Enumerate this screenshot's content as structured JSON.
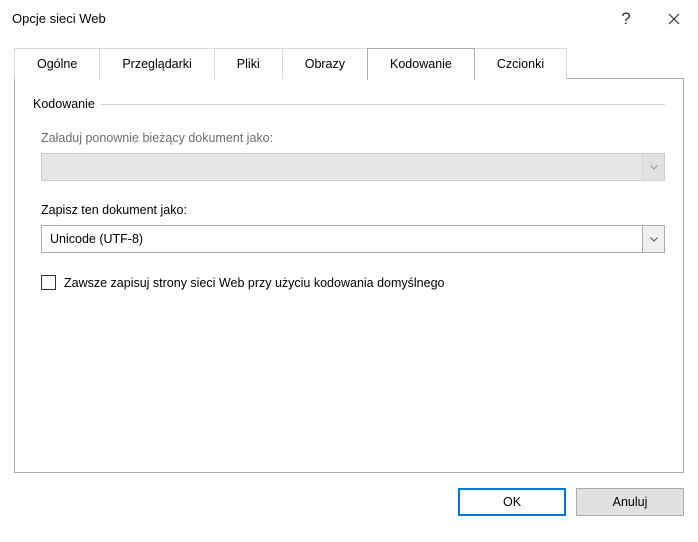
{
  "window": {
    "title": "Opcje sieci Web"
  },
  "tabs": [
    {
      "label": "Ogólne"
    },
    {
      "label": "Przeglądarki"
    },
    {
      "label": "Pliki"
    },
    {
      "label": "Obrazy"
    },
    {
      "label": "Kodowanie"
    },
    {
      "label": "Czcionki"
    }
  ],
  "panel": {
    "group_label": "Kodowanie",
    "reload_label": "Załaduj ponownie bieżący dokument jako:",
    "reload_value": "",
    "save_label": "Zapisz ten dokument jako:",
    "save_value": "Unicode (UTF-8)",
    "checkbox_label": "Zawsze zapisuj strony sieci Web przy użyciu kodowania domyślnego"
  },
  "footer": {
    "ok": "OK",
    "cancel": "Anuluj"
  }
}
